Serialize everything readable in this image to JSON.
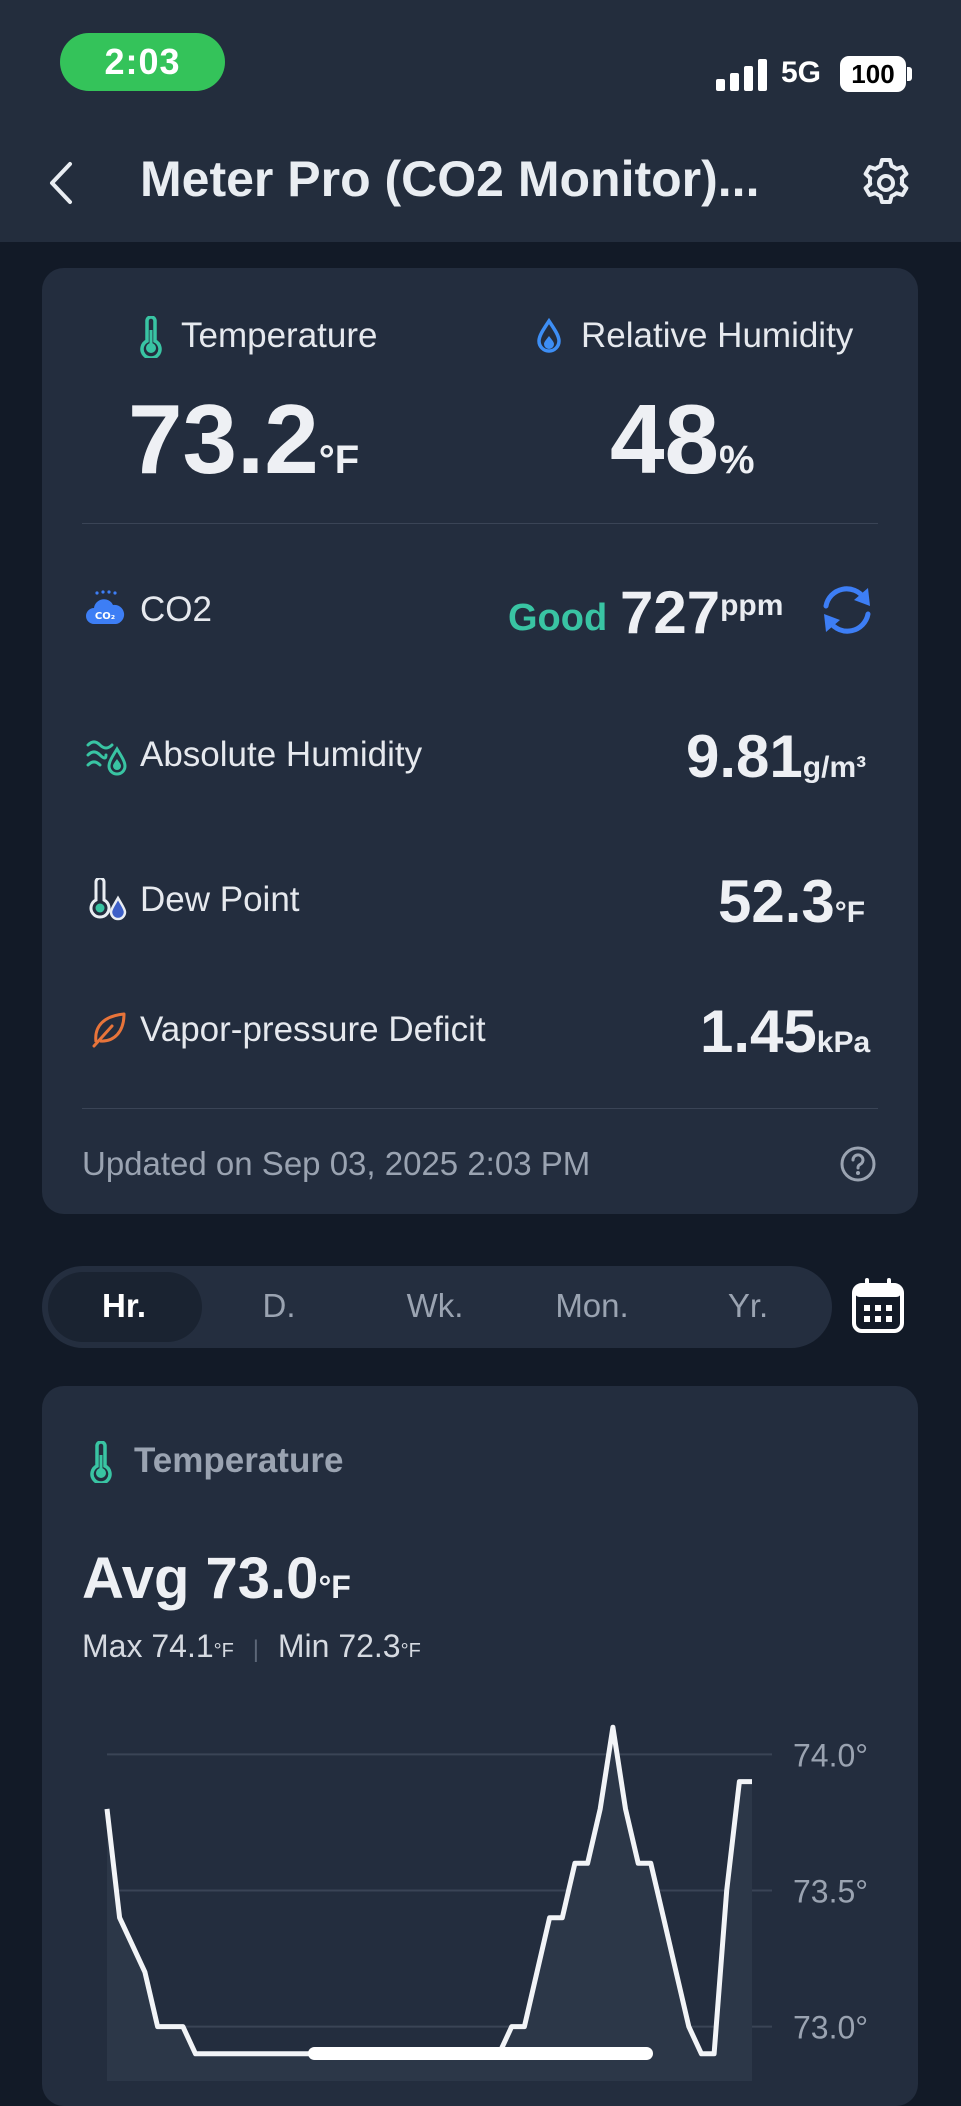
{
  "status_bar": {
    "time": "2:03",
    "network": "5G",
    "battery": "100"
  },
  "header": {
    "title": "Meter Pro (CO2 Monitor)..."
  },
  "primary": {
    "temperature": {
      "label": "Temperature",
      "value": "73.2",
      "unit": "°F"
    },
    "humidity": {
      "label": "Relative Humidity",
      "value": "48",
      "unit": "%"
    }
  },
  "metrics": {
    "co2": {
      "label": "CO2",
      "status": "Good",
      "value": "727",
      "unit": "ppm"
    },
    "absolute_humidity": {
      "label": "Absolute Humidity",
      "value": "9.81",
      "unit": "g/m³"
    },
    "dew_point": {
      "label": "Dew Point",
      "value": "52.3",
      "unit": "°F"
    },
    "vpd": {
      "label": "Vapor-pressure Deficit",
      "value": "1.45",
      "unit": "kPa"
    }
  },
  "updated": "Updated on Sep 03, 2025 2:03 PM",
  "tabs": [
    {
      "label": "Hr.",
      "active": true
    },
    {
      "label": "D.",
      "active": false
    },
    {
      "label": "Wk.",
      "active": false
    },
    {
      "label": "Mon.",
      "active": false
    },
    {
      "label": "Yr.",
      "active": false
    }
  ],
  "chart_card": {
    "title": "Temperature",
    "avg_label": "Avg",
    "avg_value": "73.0",
    "avg_unit": "°F",
    "max_label": "Max",
    "max_value": "74.1",
    "max_unit": "°F",
    "min_label": "Min",
    "min_value": "72.3",
    "min_unit": "°F"
  },
  "colors": {
    "accent": "#39c4a3",
    "sync_blue": "#3d7ef5",
    "leaf_orange": "#e8743a"
  },
  "chart_data": {
    "type": "line",
    "title": "",
    "xlabel": "",
    "ylabel": "",
    "y_ticks": [
      "74.0°",
      "73.5°",
      "73.0°"
    ],
    "y_tick_values": [
      74.0,
      73.5,
      73.0
    ],
    "ylim": [
      72.8,
      74.2
    ],
    "grid": true,
    "series": [
      {
        "values": [
          73.8,
          73.4,
          73.3,
          73.2,
          73.0,
          73.0,
          73.0,
          72.9,
          72.9,
          72.9,
          72.9,
          72.9,
          72.9,
          72.9,
          72.9,
          72.9,
          72.9,
          72.9,
          72.9,
          72.9,
          72.9,
          72.9,
          72.9,
          72.9,
          72.9,
          72.9,
          72.9,
          72.9,
          72.9,
          72.9,
          72.9,
          72.9,
          73.0,
          73.0,
          73.2,
          73.4,
          73.4,
          73.6,
          73.6,
          73.8,
          74.1,
          73.8,
          73.6,
          73.6,
          73.4,
          73.2,
          73.0,
          72.9,
          72.9,
          73.5,
          73.9,
          73.9
        ]
      }
    ]
  }
}
